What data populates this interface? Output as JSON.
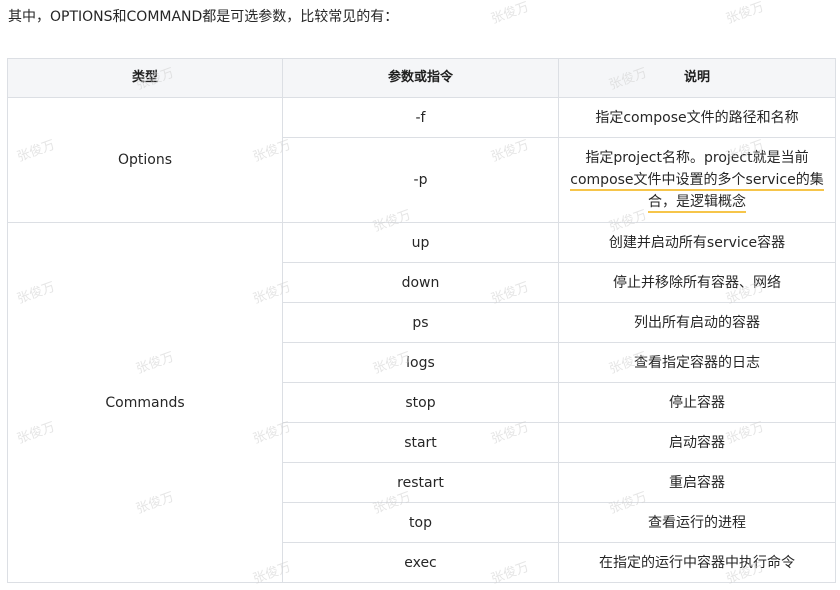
{
  "intro": "其中，OPTIONS和COMMAND都是可选参数，比较常见的有：",
  "headers": [
    "类型",
    "参数或指令",
    "说明"
  ],
  "groups": [
    {
      "type": "Options",
      "rows": [
        {
          "param": "-f",
          "desc": "指定compose文件的路径和名称"
        },
        {
          "param": "-p",
          "desc_lines": [
            "指定project名称。project就是当前",
            "compose文件中设置的多个service的集",
            "合，是逻辑概念"
          ]
        }
      ]
    },
    {
      "type": "Commands",
      "rows": [
        {
          "param": "up",
          "desc": "创建并启动所有service容器"
        },
        {
          "param": "down",
          "desc": "停止并移除所有容器、网络"
        },
        {
          "param": "ps",
          "desc": "列出所有启动的容器"
        },
        {
          "param": "logs",
          "desc": "查看指定容器的日志"
        },
        {
          "param": "stop",
          "desc": "停止容器"
        },
        {
          "param": "start",
          "desc": "启动容器"
        },
        {
          "param": "restart",
          "desc": "重启容器"
        },
        {
          "param": "top",
          "desc": "查看运行的进程"
        },
        {
          "param": "exec",
          "desc": "在指定的运行中容器中执行命令"
        }
      ]
    }
  ],
  "watermark": "张俊万"
}
